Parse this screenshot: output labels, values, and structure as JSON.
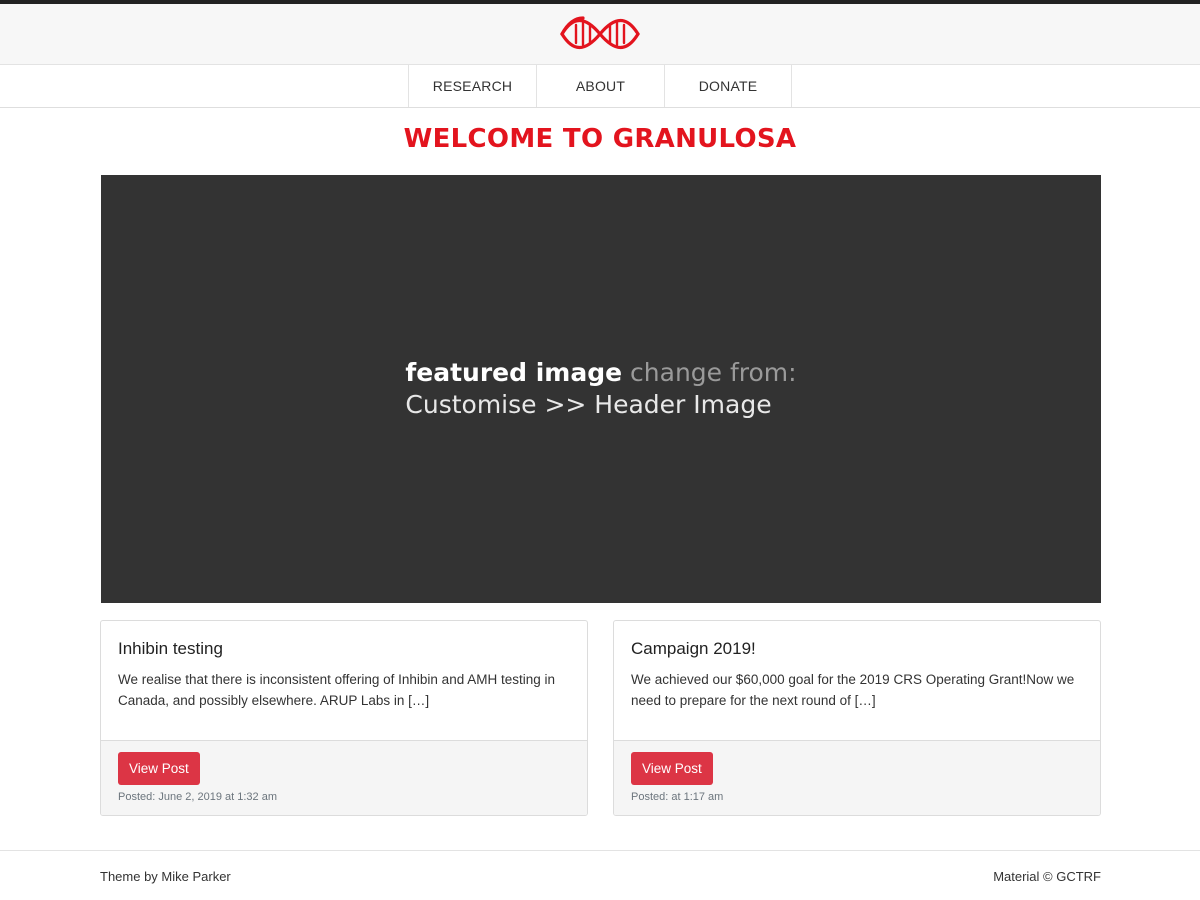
{
  "brand": {
    "logo_icon": "dna-icon",
    "accent_color": "#e3141e"
  },
  "nav": {
    "items": [
      {
        "label": "RESEARCH"
      },
      {
        "label": "ABOUT"
      },
      {
        "label": "DONATE"
      }
    ]
  },
  "page": {
    "title": "WELCOME TO GRANULOSA"
  },
  "hero": {
    "bold": "featured image",
    "light": "change from:",
    "line2": "Customise >> Header Image",
    "background": "#333333"
  },
  "posts": [
    {
      "title": "Inhibin testing",
      "excerpt": "We realise that there is inconsistent offering of Inhibin and AMH testing in Canada, and possibly elsewhere. ARUP Labs in […]",
      "button": "View Post",
      "posted": "Posted: June 2, 2019 at 1:32 am"
    },
    {
      "title": "Campaign 2019!",
      "excerpt": "We achieved our $60,000 goal for the 2019 CRS Operating Grant!Now we need to prepare for the next round of […]",
      "button": "View Post",
      "posted": "Posted: at 1:17 am"
    }
  ],
  "footer": {
    "left": "Theme by Mike Parker",
    "right": "Material © GCTRF"
  }
}
